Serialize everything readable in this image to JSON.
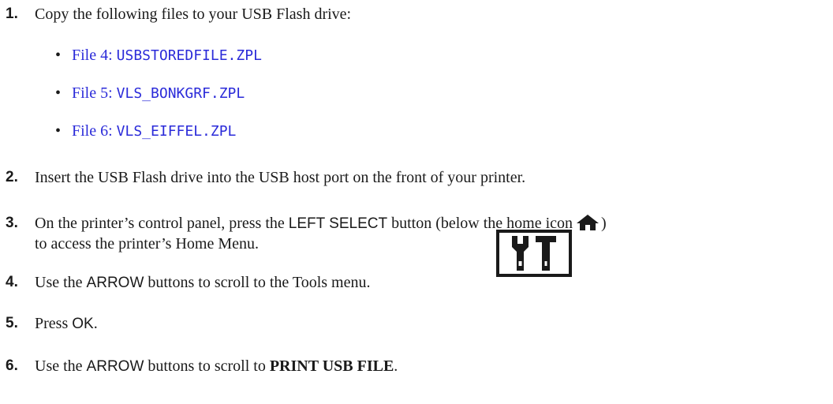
{
  "steps": [
    {
      "num": "1.",
      "text": "Copy the following files to your USB Flash drive:"
    },
    {
      "num": "2.",
      "text": "Insert the USB Flash drive into the USB host port on the front of your printer."
    },
    {
      "num": "3.",
      "pre": "On the printer’s control panel, press the ",
      "button": "LEFT SELECT",
      "mid": " button (below the home icon",
      "post": ")",
      "line2": "to access the printer’s Home Menu."
    },
    {
      "num": "4.",
      "pre": "Use the ",
      "button": "ARROW",
      "post": " buttons to scroll to the Tools menu."
    },
    {
      "num": "5.",
      "pre": "Press ",
      "button": "OK",
      "post": "."
    },
    {
      "num": "6.",
      "pre": "Use the ",
      "button": "ARROW",
      "mid": " buttons to scroll to ",
      "bold": "PRINT USB FILE",
      "post": "."
    }
  ],
  "files": [
    {
      "label": "File 4: ",
      "name": "USBSTOREDFILE.ZPL"
    },
    {
      "label": "File 5: ",
      "name": "VLS_BONKGRF.ZPL"
    },
    {
      "label": "File 6: ",
      "name": "VLS_EIFFEL.ZPL"
    }
  ],
  "bullet_char": "•",
  "icons": {
    "home": "home-icon",
    "tools": "tools-icon"
  },
  "colors": {
    "link": "#2b2bd9",
    "text": "#1a1a1a"
  }
}
